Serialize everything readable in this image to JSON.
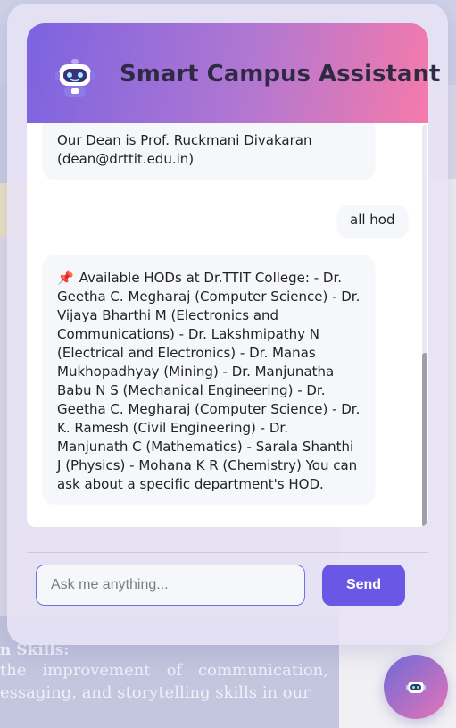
{
  "app": {
    "title": "Smart Campus Assistant"
  },
  "messages": [
    {
      "sender": "bot",
      "text": "Our Dean is Prof. Ruckmani Divakaran (dean@drttit.edu.in)"
    },
    {
      "sender": "user",
      "text": "all hod"
    },
    {
      "sender": "bot",
      "icon": "📌",
      "text": "Available HODs at Dr.TTIT College: - Dr. Geetha C. Megharaj (Computer Science) - Dr. Vijaya Bharthi M (Electronics and Communications) - Dr. Lakshmipathy N (Electrical and Electronics) - Dr. Manas Mukhopadhyay (Mining) - Dr. Manjunatha Babu N S (Mechanical Engineering) - Dr. Geetha C. Megharaj (Computer Science) - Dr. K. Ramesh (Civil Engineering) - Dr. Manjunath C (Mathematics) - Sarala Shanthi J (Physics) - Mohana K R (Chemistry) You can ask about a specific department's HOD."
    }
  ],
  "input": {
    "placeholder": "Ask me anything...",
    "value": ""
  },
  "send": {
    "label": "Send"
  },
  "background": {
    "heading": "n Skills:",
    "paragraph": "the improvement of communication, essaging, and storytelling skills in our"
  },
  "colors": {
    "accent": "#6b57e6",
    "header_start": "#7c63e0",
    "header_end": "#f57aaa"
  },
  "icons": {
    "header": "robot-icon",
    "fab": "robot-icon",
    "pin": "pushpin-icon"
  }
}
